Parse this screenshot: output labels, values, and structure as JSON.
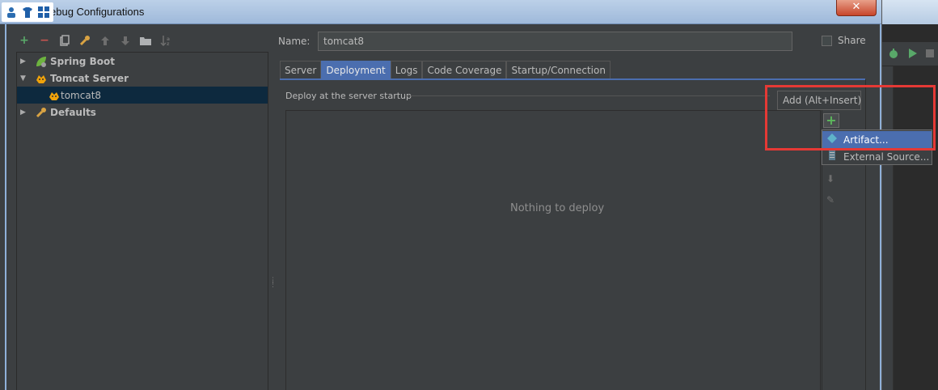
{
  "window": {
    "title": "ebug Configurations",
    "close_label": "✕"
  },
  "toolbar": {
    "items": [
      {
        "icon": "add-icon",
        "glyph": "+",
        "color": "#59a869"
      },
      {
        "icon": "remove-icon",
        "glyph": "−",
        "color": "#c75450"
      },
      {
        "icon": "copy-icon",
        "glyph": "❐",
        "color": "#aaaaaa"
      },
      {
        "icon": "wrench-icon",
        "glyph": "⚒",
        "color": "#d9a343"
      },
      {
        "icon": "move-up-icon",
        "glyph": "⬆",
        "color": "#6e6e6e"
      },
      {
        "icon": "move-down-icon",
        "glyph": "⬇",
        "color": "#6e6e6e"
      },
      {
        "icon": "folder-icon",
        "glyph": "■",
        "color": "#aaaaaa"
      },
      {
        "icon": "sort-icon",
        "glyph": "⇅",
        "color": "#6e6e6e"
      }
    ]
  },
  "tree": {
    "items": [
      {
        "label": "Spring Boot",
        "expanded": false,
        "icon": "spring-leaf-icon"
      },
      {
        "label": "Tomcat Server",
        "expanded": true,
        "icon": "tomcat-icon"
      },
      {
        "label": "tomcat8",
        "selected": true,
        "icon": "tomcat-icon"
      },
      {
        "label": "Defaults",
        "expanded": false,
        "icon": "wrench-icon"
      }
    ]
  },
  "form": {
    "name_label": "Name:",
    "name_value": "tomcat8",
    "share_label": "Share",
    "share_checked": false
  },
  "tabs": [
    "Server",
    "Deployment",
    "Logs",
    "Code Coverage",
    "Startup/Connection"
  ],
  "active_tab": "Deployment",
  "deployment": {
    "header": "Deploy at the server startup",
    "empty_text": "Nothing to deploy",
    "tooltip": "Add (Alt+Insert)"
  },
  "add_menu": {
    "items": [
      {
        "label": "Artifact...",
        "icon": "artifact-icon",
        "selected": true
      },
      {
        "label": "External Source...",
        "icon": "external-source-icon",
        "selected": false
      }
    ]
  },
  "colors": {
    "accent": "#4b6eaf",
    "highlight": "#e53935",
    "background": "#3c3f41"
  }
}
